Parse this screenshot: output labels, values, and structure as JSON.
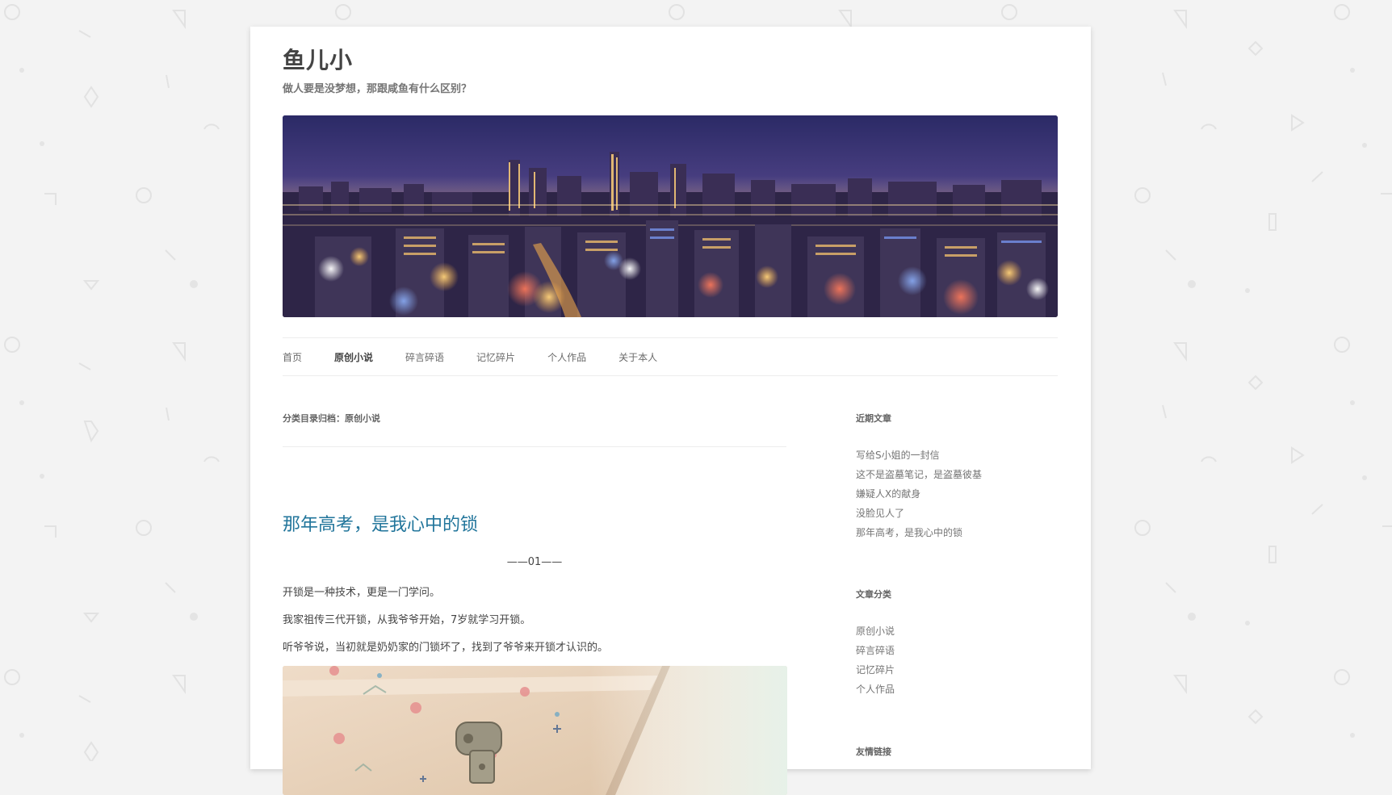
{
  "site": {
    "title": "鱼儿小",
    "description": "做人要是没梦想，那跟咸鱼有什么区别？"
  },
  "nav": {
    "items": [
      {
        "label": "首页"
      },
      {
        "label": "原创小说"
      },
      {
        "label": "碎言碎语"
      },
      {
        "label": "记忆碎片"
      },
      {
        "label": "个人作品"
      },
      {
        "label": "关于本人"
      }
    ],
    "current": "原创小说"
  },
  "archive": {
    "title": "分类目录归档：原创小说"
  },
  "post": {
    "title": "那年高考，是我心中的锁",
    "separator": "——01——",
    "paragraphs": [
      "开锁是一种技术，更是一门学问。",
      "我家祖传三代开锁，从我爷爷开始，7岁就学习开锁。",
      "听爷爷说，当初就是奶奶家的门锁坏了，找到了爷爷来开锁才认识的。"
    ]
  },
  "sidebar": {
    "recent": {
      "title": "近期文章",
      "items": [
        "写给S小姐的一封信",
        "这不是盗墓笔记，是盗墓彼基",
        "嫌疑人X的献身",
        "没脸见人了",
        "那年高考，是我心中的锁"
      ]
    },
    "categories": {
      "title": "文章分类",
      "items": [
        "原创小说",
        "碎言碎语",
        "记忆碎片",
        "个人作品"
      ]
    },
    "links": {
      "title": "友情链接"
    }
  },
  "colors": {
    "link": "#21759b",
    "page_bg": "#f3f3f3",
    "text": "#444444"
  }
}
